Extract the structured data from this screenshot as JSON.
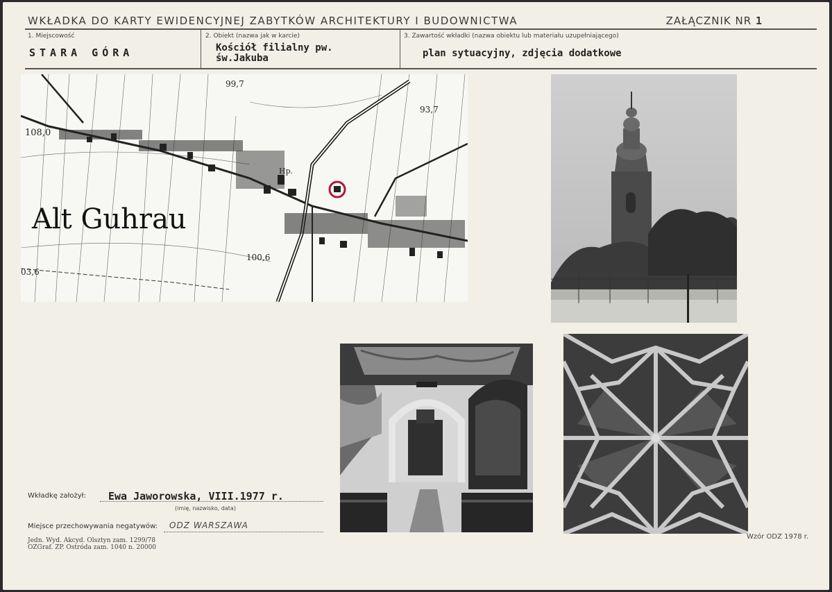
{
  "header": {
    "title": "WKŁADKA DO KARTY EWIDENCYJNEJ ZABYTKÓW ARCHITEKTURY I BUDOWNICTWA",
    "attachment_label": "ZAŁĄCZNIK NR",
    "attachment_number": "1"
  },
  "fields": {
    "place_label": "1. Miejscowość",
    "place_value": "STARA GÓRA",
    "object_label": "2. Obiekt (nazwa jak w karcie)",
    "object_value_line1": "Kościół filialny pw.",
    "object_value_line2": "św.Jakuba",
    "content_label": "3. Zawartość wkładki (nazwa obiektu lub materiału uzupełniającego)",
    "content_value": "plan sytuacyjny, zdjęcia dodatkowe"
  },
  "map": {
    "town_label": "Alt Guhrau",
    "elevations": [
      "99,7",
      "93,7",
      "108,0",
      "100,6",
      "03,6"
    ],
    "hp_label": "Hp."
  },
  "footer": {
    "founder_label": "Wkładkę założył:",
    "founder_value": "Ewa Jaworowska, VIII.1977 r.",
    "founder_hint": "(imię, nazwisko, data)",
    "storage_label": "Miejsce przechowywania negatywów:",
    "storage_value": "ODZ WARSZAWA",
    "printer_line1": "Jedn. Wyd. Akcyd. Olsztyn zam. 1299/78",
    "printer_line2": "OZGraf. ZP. Ostróda zam. 1040 n. 20000",
    "template": "Wzór ODZ 1978 r."
  },
  "photos": {
    "tower": "church-tower-photo",
    "interior": "church-interior-photo",
    "vault": "star-vault-photo"
  }
}
